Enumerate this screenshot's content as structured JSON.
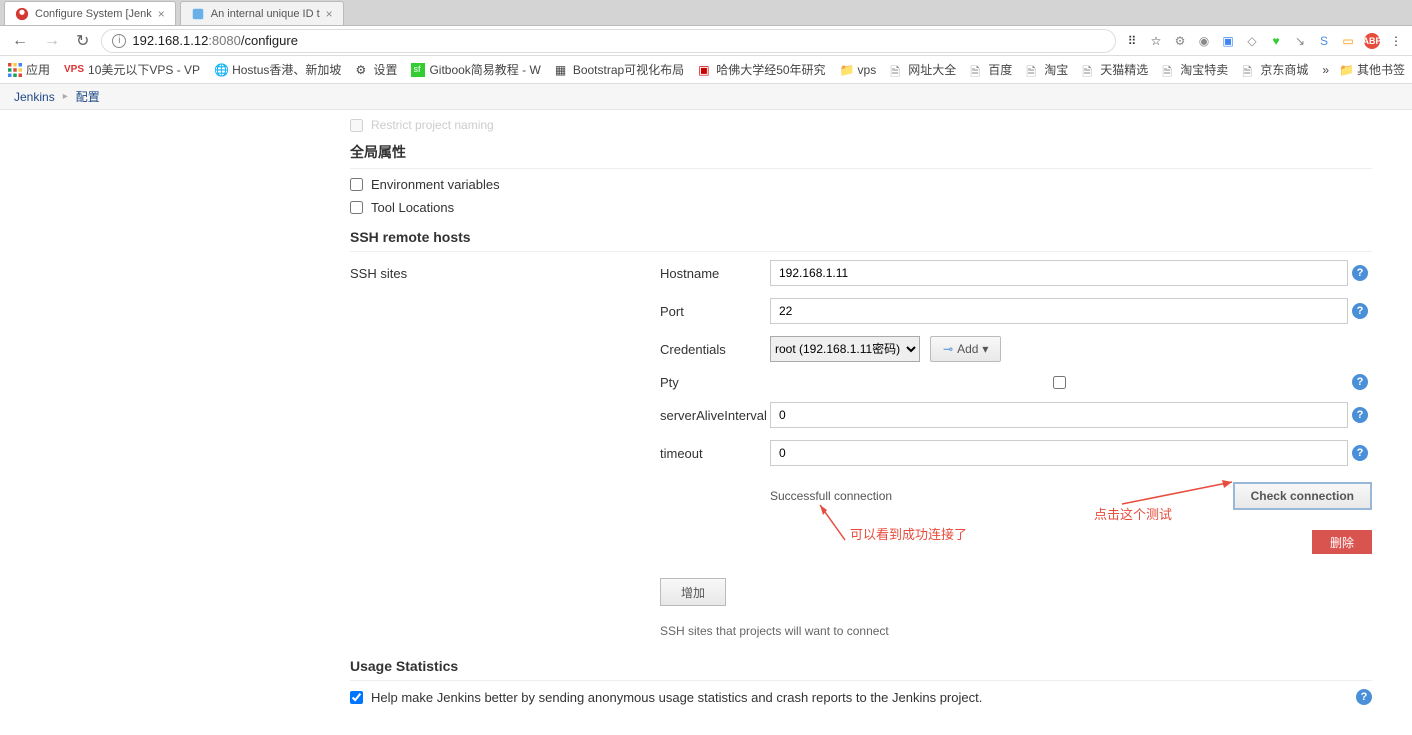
{
  "tabs": [
    {
      "title": "Configure System [Jenk"
    },
    {
      "title": "An internal unique ID t"
    }
  ],
  "url": {
    "host": "192.168.1.12",
    "port": ":8080",
    "path": "/configure"
  },
  "bookmarks": {
    "apps": "应用",
    "items": [
      "10美元以下VPS - VP",
      "Hostus香港、新加坡",
      "设置",
      "Gitbook简易教程 - W",
      "Bootstrap可视化布局",
      "哈佛大学经50年研究",
      "vps",
      "网址大全",
      "百度",
      "淘宝",
      "天猫精选",
      "淘宝特卖",
      "京东商城"
    ],
    "more": "»",
    "other": "其他书签"
  },
  "breadcrumb": {
    "root": "Jenkins",
    "current": "配置"
  },
  "sections": {
    "truncated": "Restrict project naming",
    "global_props": "全局属性",
    "env_vars": "Environment variables",
    "tool_locations": "Tool Locations",
    "ssh_remote": "SSH remote hosts",
    "ssh_sites": "SSH sites"
  },
  "fields": {
    "hostname": {
      "label": "Hostname",
      "value": "192.168.1.11"
    },
    "port": {
      "label": "Port",
      "value": "22"
    },
    "credentials": {
      "label": "Credentials",
      "selected": "root (192.168.1.11密码)",
      "add": "Add"
    },
    "pty": {
      "label": "Pty"
    },
    "serverAlive": {
      "label": "serverAliveInterval",
      "value": "0"
    },
    "timeout": {
      "label": "timeout",
      "value": "0"
    }
  },
  "result": {
    "success": "Successfull connection",
    "check_btn": "Check connection",
    "delete": "删除",
    "add_site": "增加",
    "desc": "SSH sites that projects will want to connect"
  },
  "annotations": {
    "left": "可以看到成功连接了",
    "right": "点击这个测试"
  },
  "usage": {
    "title": "Usage Statistics",
    "label": "Help make Jenkins better by sending anonymous usage statistics and crash reports to the Jenkins project."
  }
}
